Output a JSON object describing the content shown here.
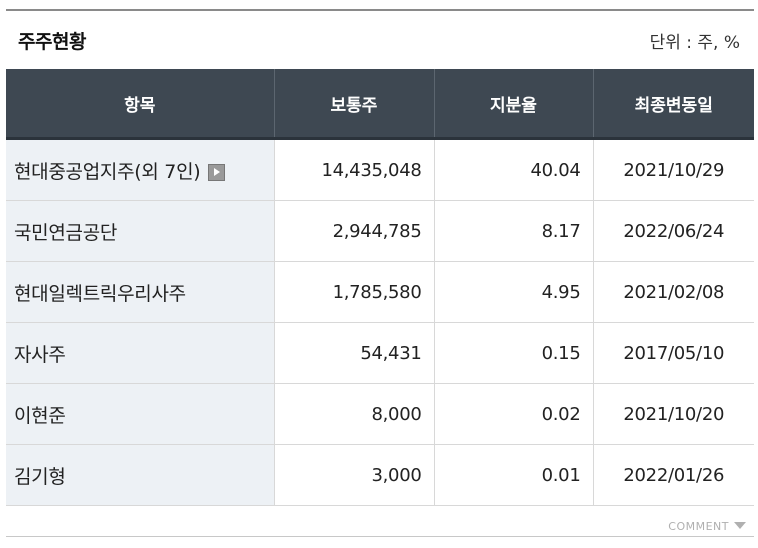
{
  "panel": {
    "title": "주주현황",
    "unit": "단위 : 주, %"
  },
  "table": {
    "headers": [
      "항목",
      "보통주",
      "지분율",
      "최종변동일"
    ],
    "rows": [
      {
        "name": "현대중공업지주(외 7인)",
        "shares": "14,435,048",
        "ratio": "40.04",
        "date": "2021/10/29"
      },
      {
        "name": "국민연금공단",
        "shares": "2,944,785",
        "ratio": "8.17",
        "date": "2022/06/24"
      },
      {
        "name": "현대일렉트릭우리사주",
        "shares": "1,785,580",
        "ratio": "4.95",
        "date": "2021/02/08"
      },
      {
        "name": "자사주",
        "shares": "54,431",
        "ratio": "0.15",
        "date": "2017/05/10"
      },
      {
        "name": "이현준",
        "shares": "8,000",
        "ratio": "0.02",
        "date": "2021/10/20"
      },
      {
        "name": "김기형",
        "shares": "3,000",
        "ratio": "0.01",
        "date": "2022/01/26"
      }
    ]
  },
  "footer": {
    "comment_label": "COMMENT"
  },
  "icons": {
    "more": "play-arrow-icon",
    "comment_toggle": "chevron-down-icon"
  }
}
